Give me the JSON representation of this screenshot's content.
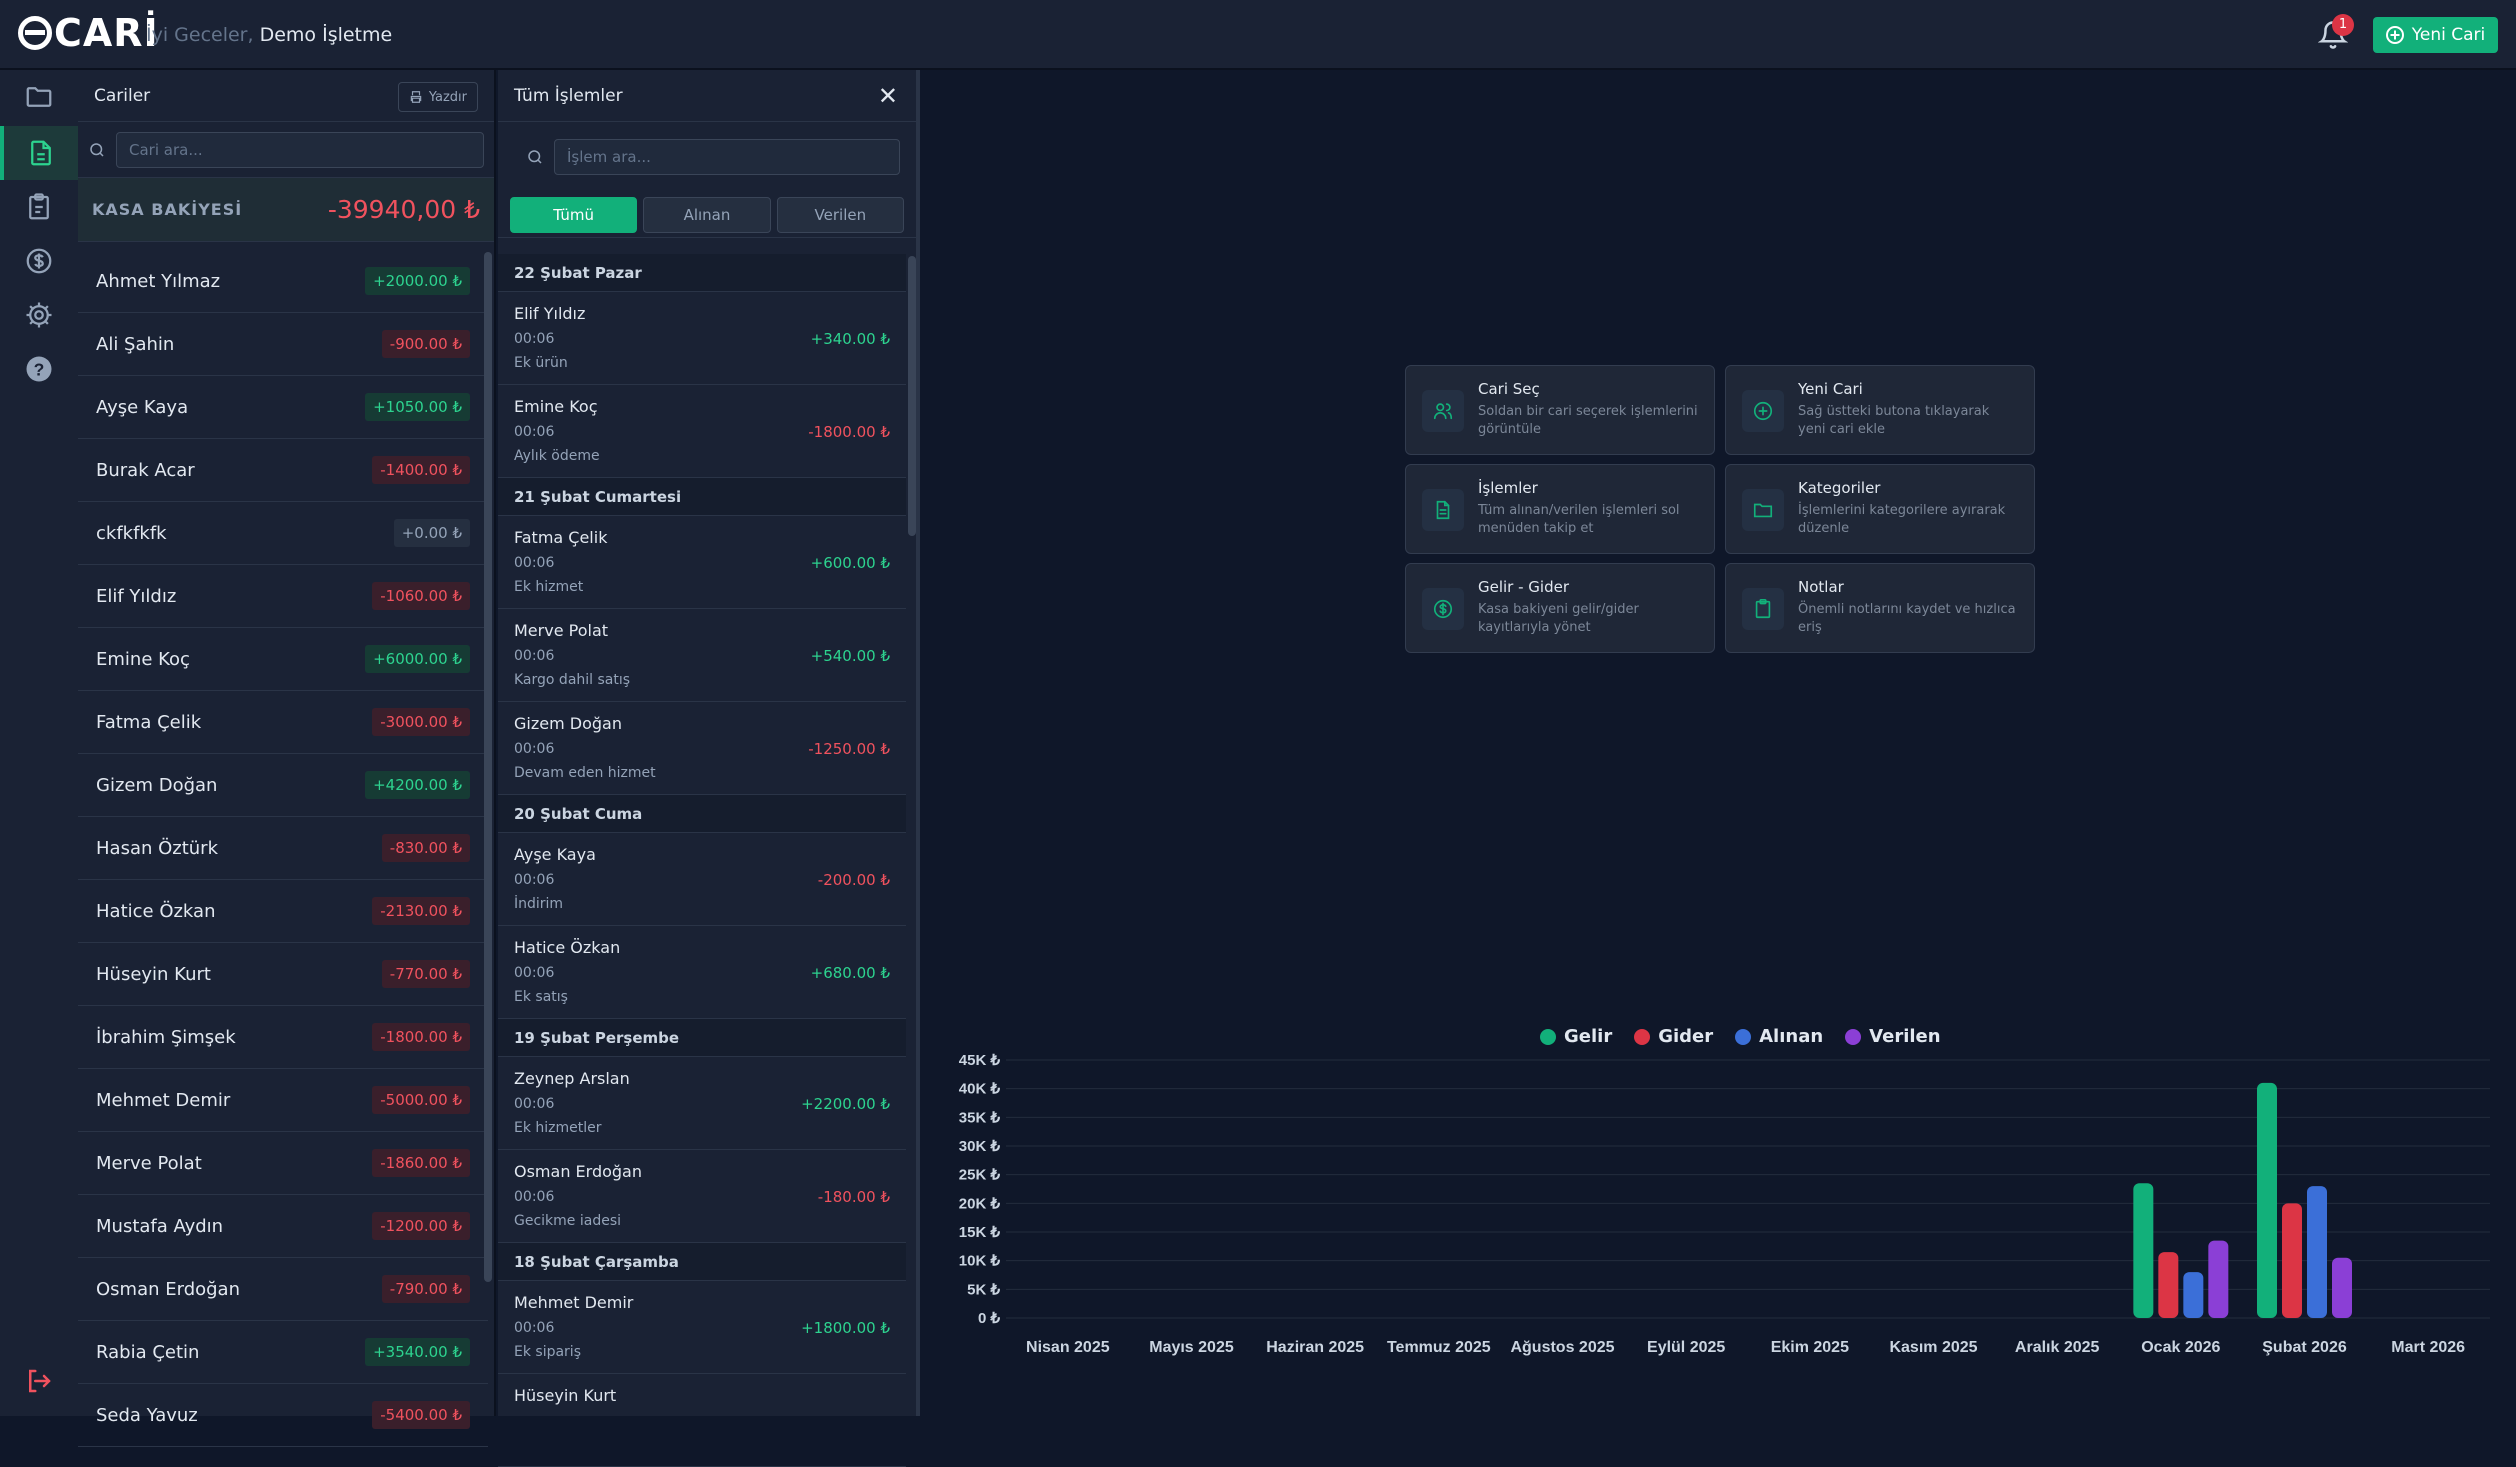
{
  "header": {
    "logo": "CARİ",
    "greeting": "İyi Geceler,",
    "business": "Demo İşletme",
    "notification_count": "1",
    "new_button": "Yeni Cari"
  },
  "cariler": {
    "title": "Cariler",
    "print_label": "Yazdır",
    "search_placeholder": "Cari ara...",
    "kasa_label": "KASA BAKİYESİ",
    "kasa_value": "-39940,00 ₺",
    "items": [
      {
        "name": "Ahmet Yılmaz",
        "amount": "+2000.00 ₺",
        "kind": "pos"
      },
      {
        "name": "Ali Şahin",
        "amount": "-900.00 ₺",
        "kind": "neg"
      },
      {
        "name": "Ayşe Kaya",
        "amount": "+1050.00 ₺",
        "kind": "pos"
      },
      {
        "name": "Burak Acar",
        "amount": "-1400.00 ₺",
        "kind": "neg"
      },
      {
        "name": "ckfkfkfk",
        "amount": "+0.00 ₺",
        "kind": "zero"
      },
      {
        "name": "Elif Yıldız",
        "amount": "-1060.00 ₺",
        "kind": "neg"
      },
      {
        "name": "Emine Koç",
        "amount": "+6000.00 ₺",
        "kind": "pos"
      },
      {
        "name": "Fatma Çelik",
        "amount": "-3000.00 ₺",
        "kind": "neg"
      },
      {
        "name": "Gizem Doğan",
        "amount": "+4200.00 ₺",
        "kind": "pos"
      },
      {
        "name": "Hasan Öztürk",
        "amount": "-830.00 ₺",
        "kind": "neg"
      },
      {
        "name": "Hatice Özkan",
        "amount": "-2130.00 ₺",
        "kind": "neg"
      },
      {
        "name": "Hüseyin Kurt",
        "amount": "-770.00 ₺",
        "kind": "neg"
      },
      {
        "name": "İbrahim Şimşek",
        "amount": "-1800.00 ₺",
        "kind": "neg"
      },
      {
        "name": "Mehmet Demir",
        "amount": "-5000.00 ₺",
        "kind": "neg"
      },
      {
        "name": "Merve Polat",
        "amount": "-1860.00 ₺",
        "kind": "neg"
      },
      {
        "name": "Mustafa Aydın",
        "amount": "-1200.00 ₺",
        "kind": "neg"
      },
      {
        "name": "Osman Erdoğan",
        "amount": "-790.00 ₺",
        "kind": "neg"
      },
      {
        "name": "Rabia Çetin",
        "amount": "+3540.00 ₺",
        "kind": "pos"
      },
      {
        "name": "Seda Yavuz",
        "amount": "-5400.00 ₺",
        "kind": "neg"
      }
    ]
  },
  "islemler": {
    "title": "Tüm İşlemler",
    "search_placeholder": "İşlem ara...",
    "tabs": [
      "Tümü",
      "Alınan",
      "Verilen"
    ],
    "groups": [
      {
        "date": "22 Şubat Pazar",
        "items": [
          {
            "name": "Elif Yıldız",
            "time": "00:06",
            "desc": "Ek ürün",
            "amount": "+340.00 ₺",
            "kind": "pos"
          },
          {
            "name": "Emine Koç",
            "time": "00:06",
            "desc": "Aylık ödeme",
            "amount": "-1800.00 ₺",
            "kind": "neg"
          }
        ]
      },
      {
        "date": "21 Şubat Cumartesi",
        "items": [
          {
            "name": "Fatma Çelik",
            "time": "00:06",
            "desc": "Ek hizmet",
            "amount": "+600.00 ₺",
            "kind": "pos"
          },
          {
            "name": "Merve Polat",
            "time": "00:06",
            "desc": "Kargo dahil satış",
            "amount": "+540.00 ₺",
            "kind": "pos"
          },
          {
            "name": "Gizem Doğan",
            "time": "00:06",
            "desc": "Devam eden hizmet",
            "amount": "-1250.00 ₺",
            "kind": "neg"
          }
        ]
      },
      {
        "date": "20 Şubat Cuma",
        "items": [
          {
            "name": "Ayşe Kaya",
            "time": "00:06",
            "desc": "İndirim",
            "amount": "-200.00 ₺",
            "kind": "neg"
          },
          {
            "name": "Hatice Özkan",
            "time": "00:06",
            "desc": "Ek satış",
            "amount": "+680.00 ₺",
            "kind": "pos"
          }
        ]
      },
      {
        "date": "19 Şubat Perşembe",
        "items": [
          {
            "name": "Zeynep Arslan",
            "time": "00:06",
            "desc": "Ek hizmetler",
            "amount": "+2200.00 ₺",
            "kind": "pos"
          },
          {
            "name": "Osman Erdoğan",
            "time": "00:06",
            "desc": "Gecikme iadesi",
            "amount": "-180.00 ₺",
            "kind": "neg"
          }
        ]
      },
      {
        "date": "18 Şubat Çarşamba",
        "items": [
          {
            "name": "Mehmet Demir",
            "time": "00:06",
            "desc": "Ek sipariş",
            "amount": "+1800.00 ₺",
            "kind": "pos"
          },
          {
            "name": "Hüseyin Kurt",
            "time": "",
            "desc": "",
            "amount": "",
            "kind": "pos"
          }
        ]
      }
    ]
  },
  "cards": [
    {
      "title": "Cari Seç",
      "desc": "Soldan bir cari seçerek işlemlerini görüntüle",
      "icon": "users-icon"
    },
    {
      "title": "Yeni Cari",
      "desc": "Sağ üstteki butona tıklayarak yeni cari ekle",
      "icon": "plus-circle-icon"
    },
    {
      "title": "İşlemler",
      "desc": "Tüm alınan/verilen işlemleri sol menüden takip et",
      "icon": "document-icon"
    },
    {
      "title": "Kategoriler",
      "desc": "İşlemlerini kategorilere ayırarak düzenle",
      "icon": "folder-icon"
    },
    {
      "title": "Gelir - Gider",
      "desc": "Kasa bakiyeni gelir/gider kayıtlarıyla yönet",
      "icon": "dollar-icon"
    },
    {
      "title": "Notlar",
      "desc": "Önemli notlarını kaydet ve hızlıca eriş",
      "icon": "clipboard-icon"
    }
  ],
  "colors": {
    "accent": "#12b07a",
    "gelir": "#12b07a",
    "gider": "#dc3545",
    "alinan": "#3b6fd8",
    "verilen": "#8b3fd6"
  },
  "chart_data": {
    "type": "bar",
    "categories": [
      "Nisan 2025",
      "Mayıs 2025",
      "Haziran 2025",
      "Temmuz 2025",
      "Ağustos 2025",
      "Eylül 2025",
      "Ekim 2025",
      "Kasım 2025",
      "Aralık 2025",
      "Ocak 2026",
      "Şubat 2026",
      "Mart 2026"
    ],
    "series": [
      {
        "name": "Gelir",
        "color": "#12b07a",
        "values": [
          0,
          0,
          0,
          0,
          0,
          0,
          0,
          0,
          0,
          23500,
          41000,
          0
        ]
      },
      {
        "name": "Gider",
        "color": "#dc3545",
        "values": [
          0,
          0,
          0,
          0,
          0,
          0,
          0,
          0,
          0,
          11500,
          20000,
          0
        ]
      },
      {
        "name": "Alınan",
        "color": "#3b6fd8",
        "values": [
          0,
          0,
          0,
          0,
          0,
          0,
          0,
          0,
          0,
          8000,
          23000,
          0
        ]
      },
      {
        "name": "Verilen",
        "color": "#8b3fd6",
        "values": [
          0,
          0,
          0,
          0,
          0,
          0,
          0,
          0,
          0,
          13500,
          10500,
          0
        ]
      }
    ],
    "yticks": [
      "45K ₺",
      "40K ₺",
      "35K ₺",
      "30K ₺",
      "25K ₺",
      "20K ₺",
      "15K ₺",
      "10K ₺",
      "5K ₺",
      "0 ₺"
    ],
    "ylim": [
      0,
      45000
    ],
    "grid": true,
    "legend": "top-center"
  }
}
